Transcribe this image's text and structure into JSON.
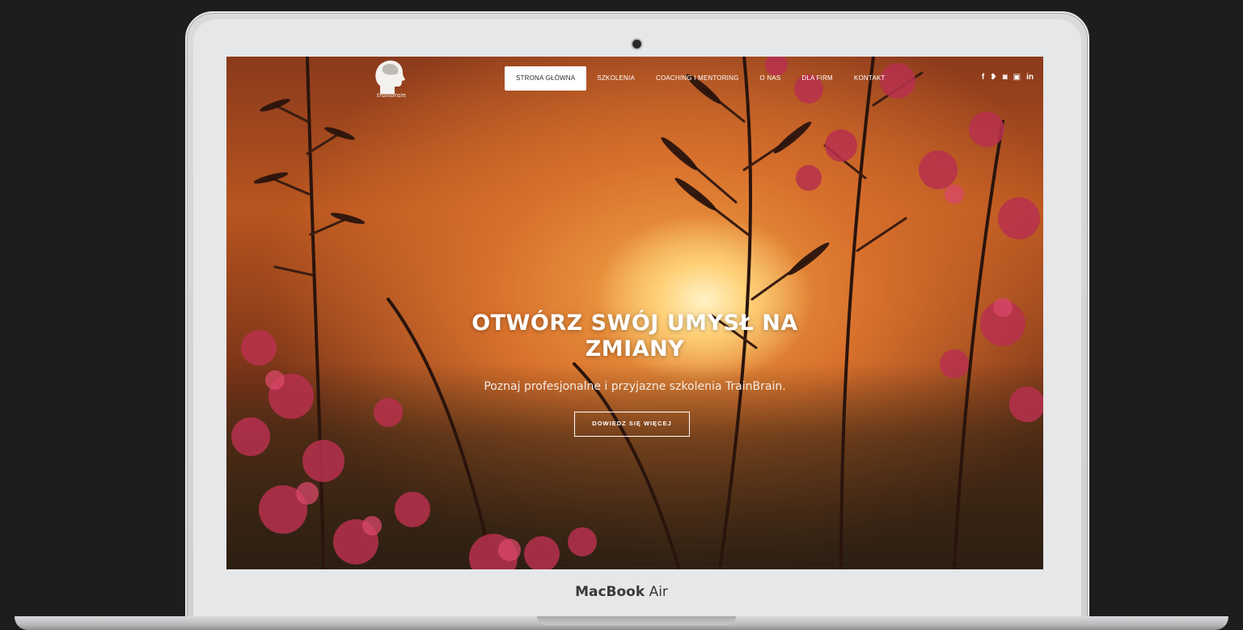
{
  "device": {
    "label_bold": "MacBook",
    "label_light": "Air"
  },
  "site": {
    "logo_text": "trainbrain",
    "nav": [
      {
        "label": "STRONA GŁÓWNA",
        "active": true
      },
      {
        "label": "SZKOLENIA",
        "active": false
      },
      {
        "label": "COACHING I MENTORING",
        "active": false
      },
      {
        "label": "O NAS",
        "active": false
      },
      {
        "label": "DLA FIRM",
        "active": false
      },
      {
        "label": "KONTAKT",
        "active": false
      }
    ],
    "social": [
      {
        "icon": "facebook-icon",
        "glyph": "f"
      },
      {
        "icon": "twitter-icon",
        "glyph": "❥"
      },
      {
        "icon": "instagram-icon",
        "glyph": "◙"
      },
      {
        "icon": "youtube-icon",
        "glyph": "▣"
      },
      {
        "icon": "linkedin-icon",
        "glyph": "in"
      }
    ]
  },
  "hero": {
    "title": "OTWÓRZ SWÓJ UMYSŁ NA ZMIANY",
    "subtitle": "Poznaj profesjonalne i przyjazne szkolenia TrainBrain.",
    "button_label": "DOWIEDZ SIĘ WIĘCEJ"
  }
}
